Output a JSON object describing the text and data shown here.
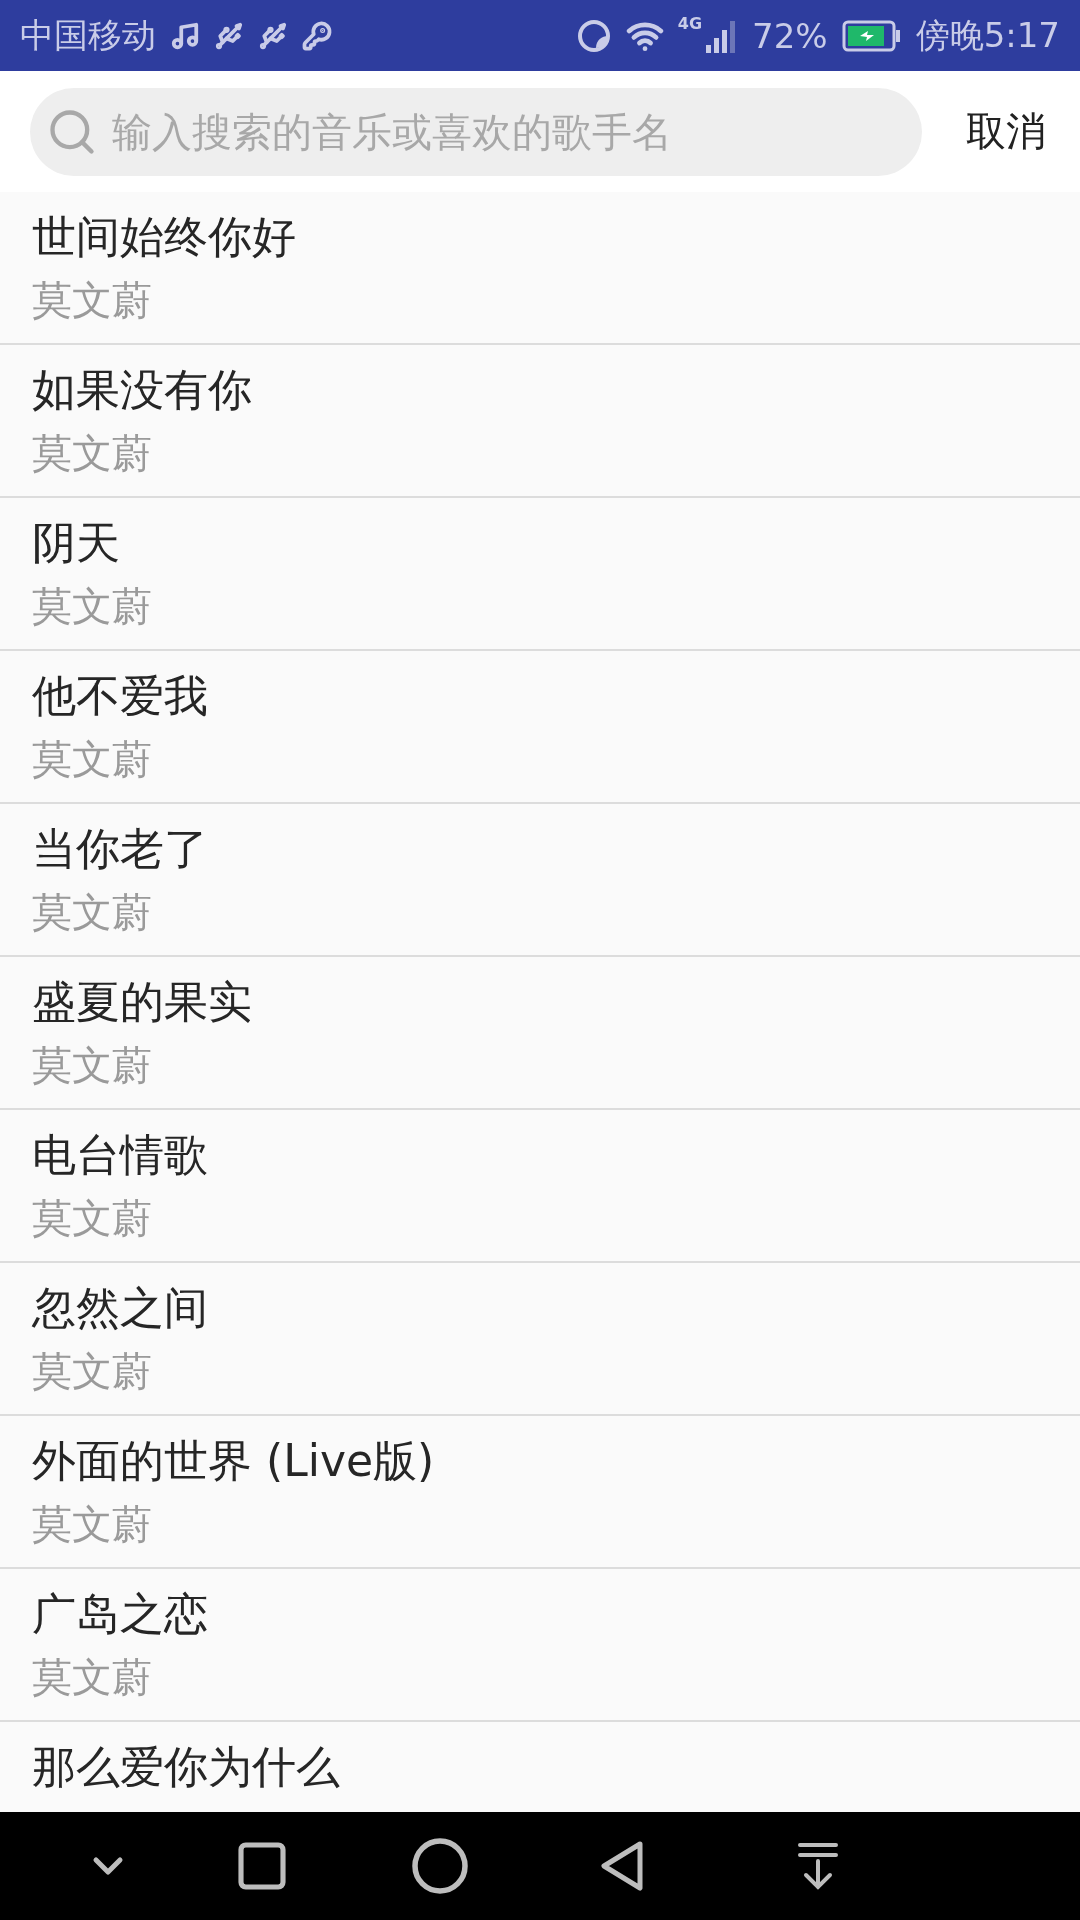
{
  "status_bar": {
    "carrier": "中国移动",
    "network": "4G",
    "battery": "72%",
    "time": "傍晚5:17"
  },
  "search": {
    "placeholder": "输入搜索的音乐或喜欢的歌手名",
    "cancel": "取消"
  },
  "songs": [
    {
      "title": "世间始终你好",
      "artist": "莫文蔚"
    },
    {
      "title": "如果没有你",
      "artist": "莫文蔚"
    },
    {
      "title": "阴天",
      "artist": "莫文蔚"
    },
    {
      "title": "他不爱我",
      "artist": "莫文蔚"
    },
    {
      "title": "当你老了",
      "artist": "莫文蔚"
    },
    {
      "title": "盛夏的果实",
      "artist": "莫文蔚"
    },
    {
      "title": "电台情歌",
      "artist": "莫文蔚"
    },
    {
      "title": "忽然之间",
      "artist": "莫文蔚"
    },
    {
      "title": "外面的世界 (Live版)",
      "artist": "莫文蔚"
    },
    {
      "title": "广岛之恋",
      "artist": "莫文蔚"
    },
    {
      "title": "那么爱你为什么"
    }
  ]
}
